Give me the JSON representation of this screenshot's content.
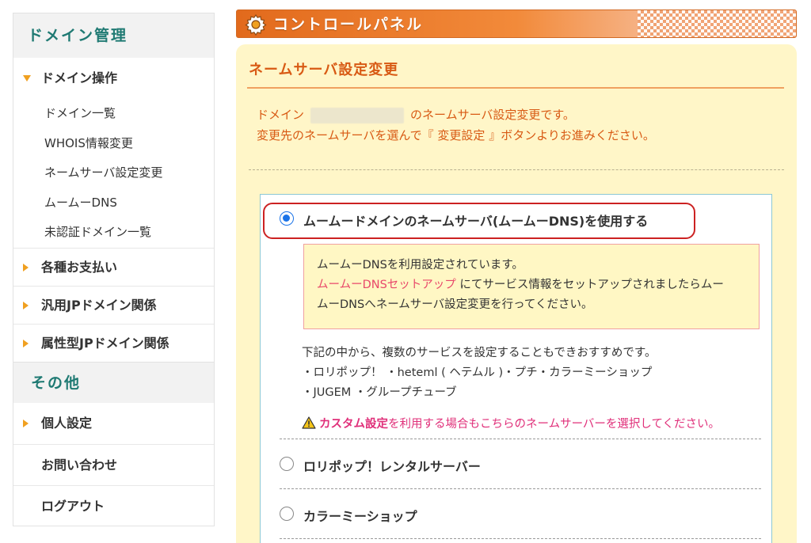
{
  "sidebar": {
    "domain_header": "ドメイン管理",
    "domain_ops": "ドメイン操作",
    "sub_items": [
      "ドメイン一覧",
      "WHOIS情報変更",
      "ネームサーバ設定変更",
      "ムームーDNS",
      "未認証ドメイン一覧"
    ],
    "payments": "各種お支払い",
    "generic_jp": "汎用JPドメイン関係",
    "attribute_jp": "属性型JPドメイン関係",
    "other_header": "その他",
    "personal": "個人設定",
    "contact": "お問い合わせ",
    "logout": "ログアウト"
  },
  "header": {
    "title": "コントロールパネル"
  },
  "panel": {
    "title": "ネームサーバ設定変更",
    "intro_prefix": "ドメイン",
    "intro_suffix": "のネームサーバ設定変更です。",
    "intro_line2": "変更先のネームサーバを選んで『 変更設定 』ボタンよりお進みください。"
  },
  "options": {
    "muumuu": "ムームードメインのネームサーバ(ムームーDNS)を使用する",
    "info_line1": "ムームーDNSを利用設定されています。",
    "info_link": "ムームーDNSセットアップ",
    "info_line2_rest": " にてサービス情報をセットアップされましたらムー",
    "info_line3": "ムーDNSへネームサーバ設定変更を行ってください。",
    "desc_line1": "下記の中から、複数のサービスを設定することもできおすすめです。",
    "desc_line2": "・ロリポップ！ ・heteml ( ヘテムル )・プチ・カラーミーショップ",
    "desc_line3": "・JUGEM ・グループチューブ",
    "warn_bold": "カスタム設定",
    "warn_rest": "を利用する場合もこちらのネームサーバーを選択してください。",
    "lolipop": "ロリポップ！レンタルサーバー",
    "colorme": "カラーミーショップ"
  }
}
